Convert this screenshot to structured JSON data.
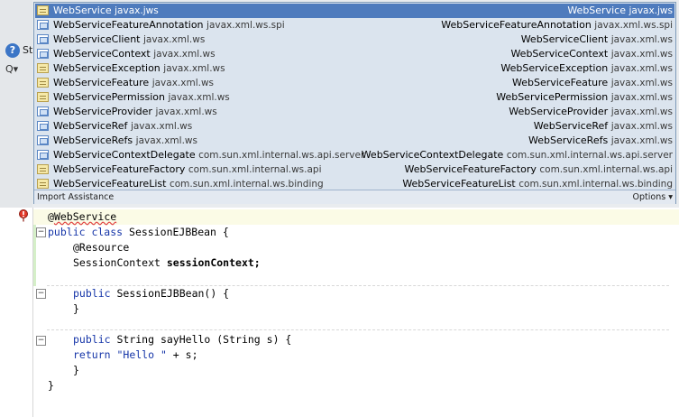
{
  "ide": {
    "help_glyph": "?",
    "panel_label": "St",
    "search_glyph": "Q▾"
  },
  "popup": {
    "items": [
      {
        "name": "WebService",
        "pkg": "javax.jws",
        "type": "annotation",
        "selected": true
      },
      {
        "name": "WebServiceFeatureAnnotation",
        "pkg": "javax.xml.ws.spi",
        "type": "interface"
      },
      {
        "name": "WebServiceClient",
        "pkg": "javax.xml.ws",
        "type": "interface"
      },
      {
        "name": "WebServiceContext",
        "pkg": "javax.xml.ws",
        "type": "interface"
      },
      {
        "name": "WebServiceException",
        "pkg": "javax.xml.ws",
        "type": "annotation"
      },
      {
        "name": "WebServiceFeature",
        "pkg": "javax.xml.ws",
        "type": "annotation"
      },
      {
        "name": "WebServicePermission",
        "pkg": "javax.xml.ws",
        "type": "annotation"
      },
      {
        "name": "WebServiceProvider",
        "pkg": "javax.xml.ws",
        "type": "interface"
      },
      {
        "name": "WebServiceRef",
        "pkg": "javax.xml.ws",
        "type": "interface"
      },
      {
        "name": "WebServiceRefs",
        "pkg": "javax.xml.ws",
        "type": "interface"
      },
      {
        "name": "WebServiceContextDelegate",
        "pkg": "com.sun.xml.internal.ws.api.server",
        "type": "interface"
      },
      {
        "name": "WebServiceFeatureFactory",
        "pkg": "com.sun.xml.internal.ws.api",
        "type": "annotation"
      },
      {
        "name": "WebServiceFeatureList",
        "pkg": "com.sun.xml.internal.ws.binding",
        "type": "annotation"
      }
    ],
    "footer_left": "Import Assistance",
    "footer_right": "Options ▾"
  },
  "code": {
    "annotation_at": "@",
    "annotation_name": "WebService",
    "class_kw": "public class",
    "class_name": "SessionEJBBean {",
    "resource": "@Resource",
    "field_type": "SessionContext",
    "field_name": "sessionContext;",
    "ctor_kw": "public",
    "ctor": "SessionEJBBean() {",
    "close1": "}",
    "method_kw": "public",
    "method_sig": "String sayHello (String s) {",
    "return_kw": "return",
    "return_str": "\"Hello \"",
    "return_rest": " + s;",
    "close2": "}",
    "close3": "}"
  }
}
